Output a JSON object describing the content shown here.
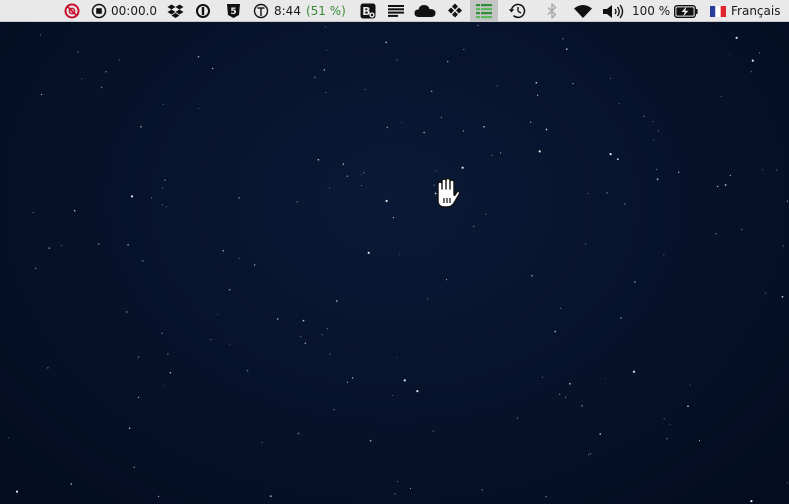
{
  "menubar": {
    "stopwatch_time": "00:00.0",
    "clock_time": "8:44",
    "clock_percent": "(51 %)",
    "battery_percent": "100 %",
    "input_language": "Français"
  },
  "colors": {
    "menubar_bg": "#e9e9e9",
    "desktop_bg": "#06122a",
    "progress_green": "#3a8a3a",
    "red_icon": "#c8102e"
  },
  "icons": [
    "red-lifebuoy-icon",
    "stop-circle-icon",
    "dropbox-icon",
    "1password-icon",
    "shield-5-icon",
    "timer-dial-icon",
    "bartender-icon",
    "text-lines-icon",
    "cloud-icon",
    "diamond-dots-icon",
    "green-list-icon",
    "time-machine-icon",
    "bluetooth-icon",
    "wifi-icon",
    "volume-icon",
    "battery-charging-icon",
    "french-flag-icon",
    "hand-cursor-icon"
  ]
}
